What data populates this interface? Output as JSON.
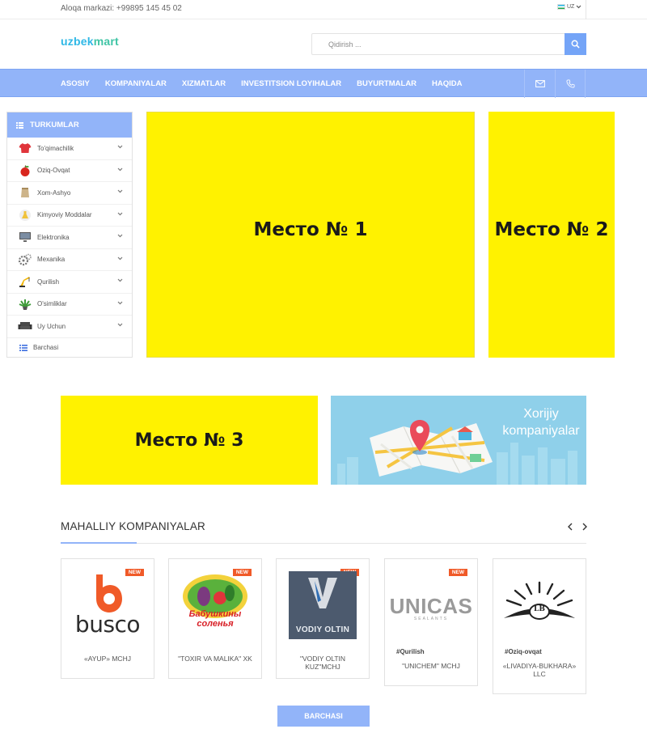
{
  "topbar": {
    "contact": "Aloqa markazi: +99895 145 45 02",
    "lang": "UZ"
  },
  "header": {
    "logo_part1": "uzbek",
    "logo_part2": "mart",
    "search_placeholder": "Qidirish ..."
  },
  "nav": {
    "items": [
      "ASOSIY",
      "KOMPANIYALAR",
      "XIZMATLAR",
      "INVESTITSION LOYIHALAR",
      "BUYURTMALAR",
      "HAQIDA"
    ]
  },
  "categories": {
    "title": "TURKUMLAR",
    "items": [
      {
        "label": "To'qimachilik",
        "icon": "tshirt-icon"
      },
      {
        "label": "Oziq-Ovqat",
        "icon": "apple-icon"
      },
      {
        "label": "Xom-Ashyo",
        "icon": "sack-icon"
      },
      {
        "label": "Kimyoviy Moddalar",
        "icon": "flask-icon"
      },
      {
        "label": "Elektronika",
        "icon": "monitor-icon"
      },
      {
        "label": "Mexanika",
        "icon": "gears-icon"
      },
      {
        "label": "Qurilish",
        "icon": "crane-icon"
      },
      {
        "label": "O'simliklar",
        "icon": "plant-icon"
      },
      {
        "label": "Uy Uchun",
        "icon": "sofa-icon"
      }
    ],
    "all_label": "Barchasi"
  },
  "ads": {
    "place1": "Место № 1",
    "place2": "Место № 2",
    "place3": "Место № 3"
  },
  "foreign_banner": {
    "line1": "Xorijiy",
    "line2": "kompaniyalar"
  },
  "local": {
    "title": "MAHALLIY KOMPANIYALAR",
    "badge": "NEW",
    "companies": [
      {
        "logo_text": "busco",
        "tag": "",
        "name": "«AYUP» MCHJ"
      },
      {
        "logo_text": "Бабушкины соленья",
        "tag": "",
        "name": "\"TOXIR VA MALIKA\" XK"
      },
      {
        "logo_text": "VODIY OLTIN",
        "tag": "",
        "name": "\"VODIY OLTIN KUZ\"MCHJ"
      },
      {
        "logo_text": "UNICAS",
        "logo_sub": "SEALANTS",
        "tag": "#Qurilish",
        "name": "\"UNICHEM\" MCHJ"
      },
      {
        "logo_text": "LB",
        "tag": "#Oziq-ovqat",
        "name": "«LIVADIYA-BUKHARA» LLC"
      }
    ],
    "all_button": "BARCHASI"
  },
  "colors": {
    "accent": "#92b4f9",
    "ad_yellow": "#fff200",
    "badge": "#f05a28"
  }
}
